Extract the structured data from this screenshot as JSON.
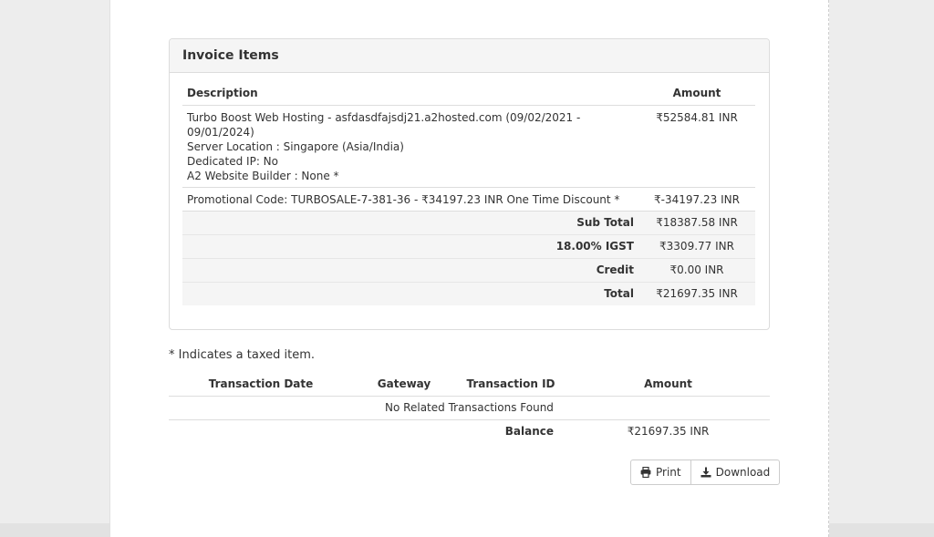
{
  "invoice": {
    "panel_title": "Invoice Items",
    "columns": {
      "description": "Description",
      "amount": "Amount"
    },
    "items": [
      {
        "lines": [
          "Turbo Boost Web Hosting - asfdasdfajsdj21.a2hosted.com (09/02/2021 -",
          "09/01/2024)",
          "Server Location : Singapore (Asia/India)",
          "Dedicated IP: No",
          "A2 Website Builder : None *"
        ],
        "amount": "₹52584.81 INR"
      },
      {
        "lines": [
          "Promotional Code: TURBOSALE-7-381-36 - ₹34197.23 INR One Time Discount *"
        ],
        "amount": "₹-34197.23 INR"
      }
    ],
    "summary": [
      {
        "label": "Sub Total",
        "value": "₹18387.58 INR"
      },
      {
        "label": "18.00% IGST",
        "value": "₹3309.77 INR"
      },
      {
        "label": "Credit",
        "value": "₹0.00 INR"
      },
      {
        "label": "Total",
        "value": "₹21697.35 INR"
      }
    ]
  },
  "taxed_note": "* Indicates a taxed item.",
  "transactions": {
    "columns": {
      "date": "Transaction Date",
      "gateway": "Gateway",
      "id": "Transaction ID",
      "amount": "Amount"
    },
    "empty_message": "No Related Transactions Found",
    "balance_label": "Balance",
    "balance_value": "₹21697.35 INR"
  },
  "actions": {
    "print_label": "Print",
    "print_icon": "print-icon",
    "download_label": "Download",
    "download_icon": "download-icon"
  }
}
